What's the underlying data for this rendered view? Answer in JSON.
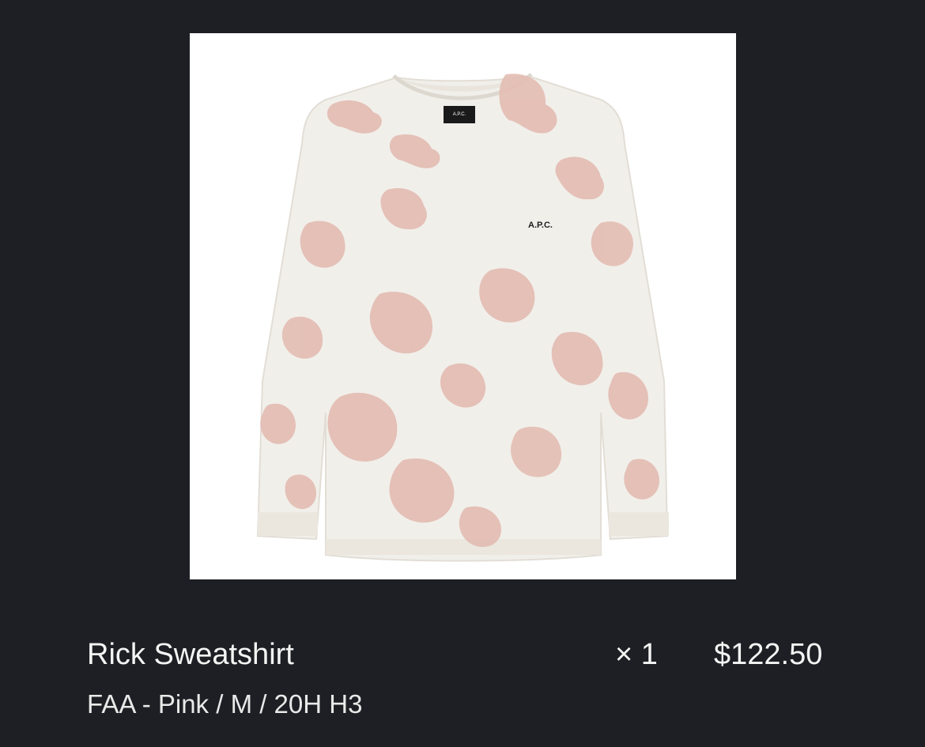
{
  "item": {
    "name": "Rick Sweatshirt",
    "variant": "FAA - Pink / M / 20H H3",
    "quantity": "× 1",
    "price": "$122.50"
  },
  "image": {
    "alt": "Rick Sweatshirt",
    "chest_logo": "A.P.C.",
    "neck_label": "A.P.C.",
    "colors": {
      "background": "#ffffff",
      "garment": "#f1efea",
      "dye": "#e3bcb2"
    }
  }
}
